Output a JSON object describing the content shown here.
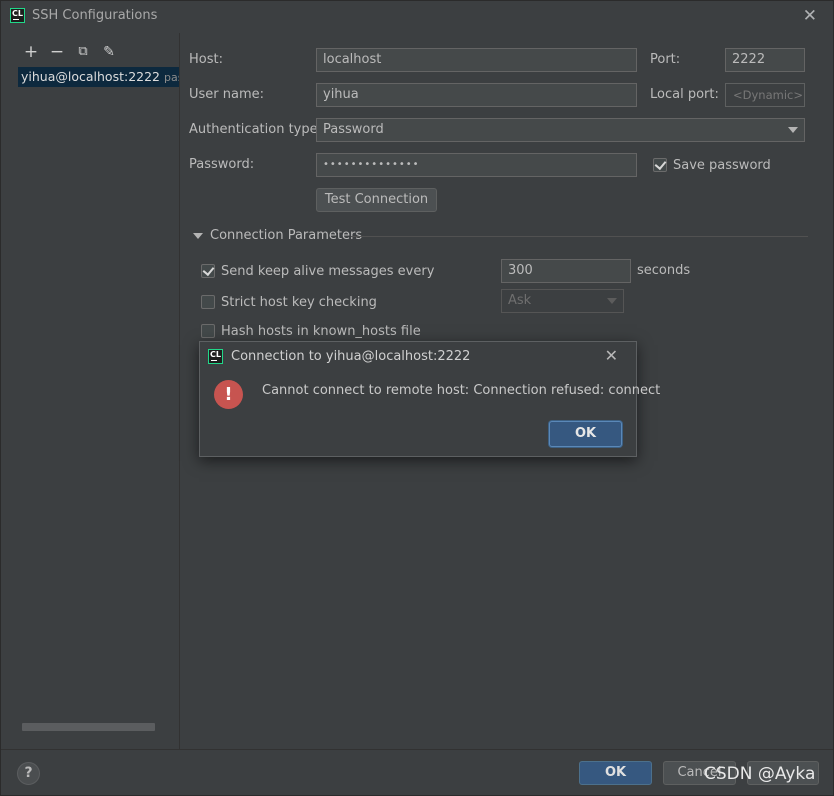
{
  "window": {
    "title": "SSH Configurations",
    "logo": "CL"
  },
  "sidebar": {
    "item_label": "yihua@localhost:2222",
    "item_sub": "passv"
  },
  "form": {
    "host_label": "Host:",
    "host_value": "localhost",
    "port_label": "Port:",
    "port_value": "2222",
    "user_label": "User name:",
    "user_value": "yihua",
    "local_port_label": "Local port:",
    "local_port_placeholder": "<Dynamic>",
    "auth_label": "Authentication type:",
    "auth_value": "Password",
    "password_label": "Password:",
    "password_value": "••••••••••••••",
    "save_password_label": "Save password",
    "save_password_checked": true,
    "test_button": "Test Connection"
  },
  "params": {
    "section_title": "Connection Parameters",
    "keepalive_label": "Send keep alive messages every",
    "keepalive_checked": true,
    "keepalive_value": "300",
    "keepalive_unit": "seconds",
    "strict_label": "Strict host key checking",
    "strict_checked": false,
    "strict_value": "Ask",
    "hash_label": "Hash hosts in known_hosts file",
    "hash_checked": false
  },
  "dialog": {
    "title": "Connection to yihua@localhost:2222",
    "message": "Cannot connect to remote host: Connection refused: connect",
    "ok": "OK",
    "icon": "error-icon"
  },
  "footer": {
    "help": "?",
    "ok": "OK",
    "cancel": "Cancel",
    "watermark": "CSDN @Ayka"
  },
  "colors": {
    "background": "#3c3f41",
    "selection": "#0d293e",
    "primary": "#365880",
    "error": "#c75450"
  }
}
